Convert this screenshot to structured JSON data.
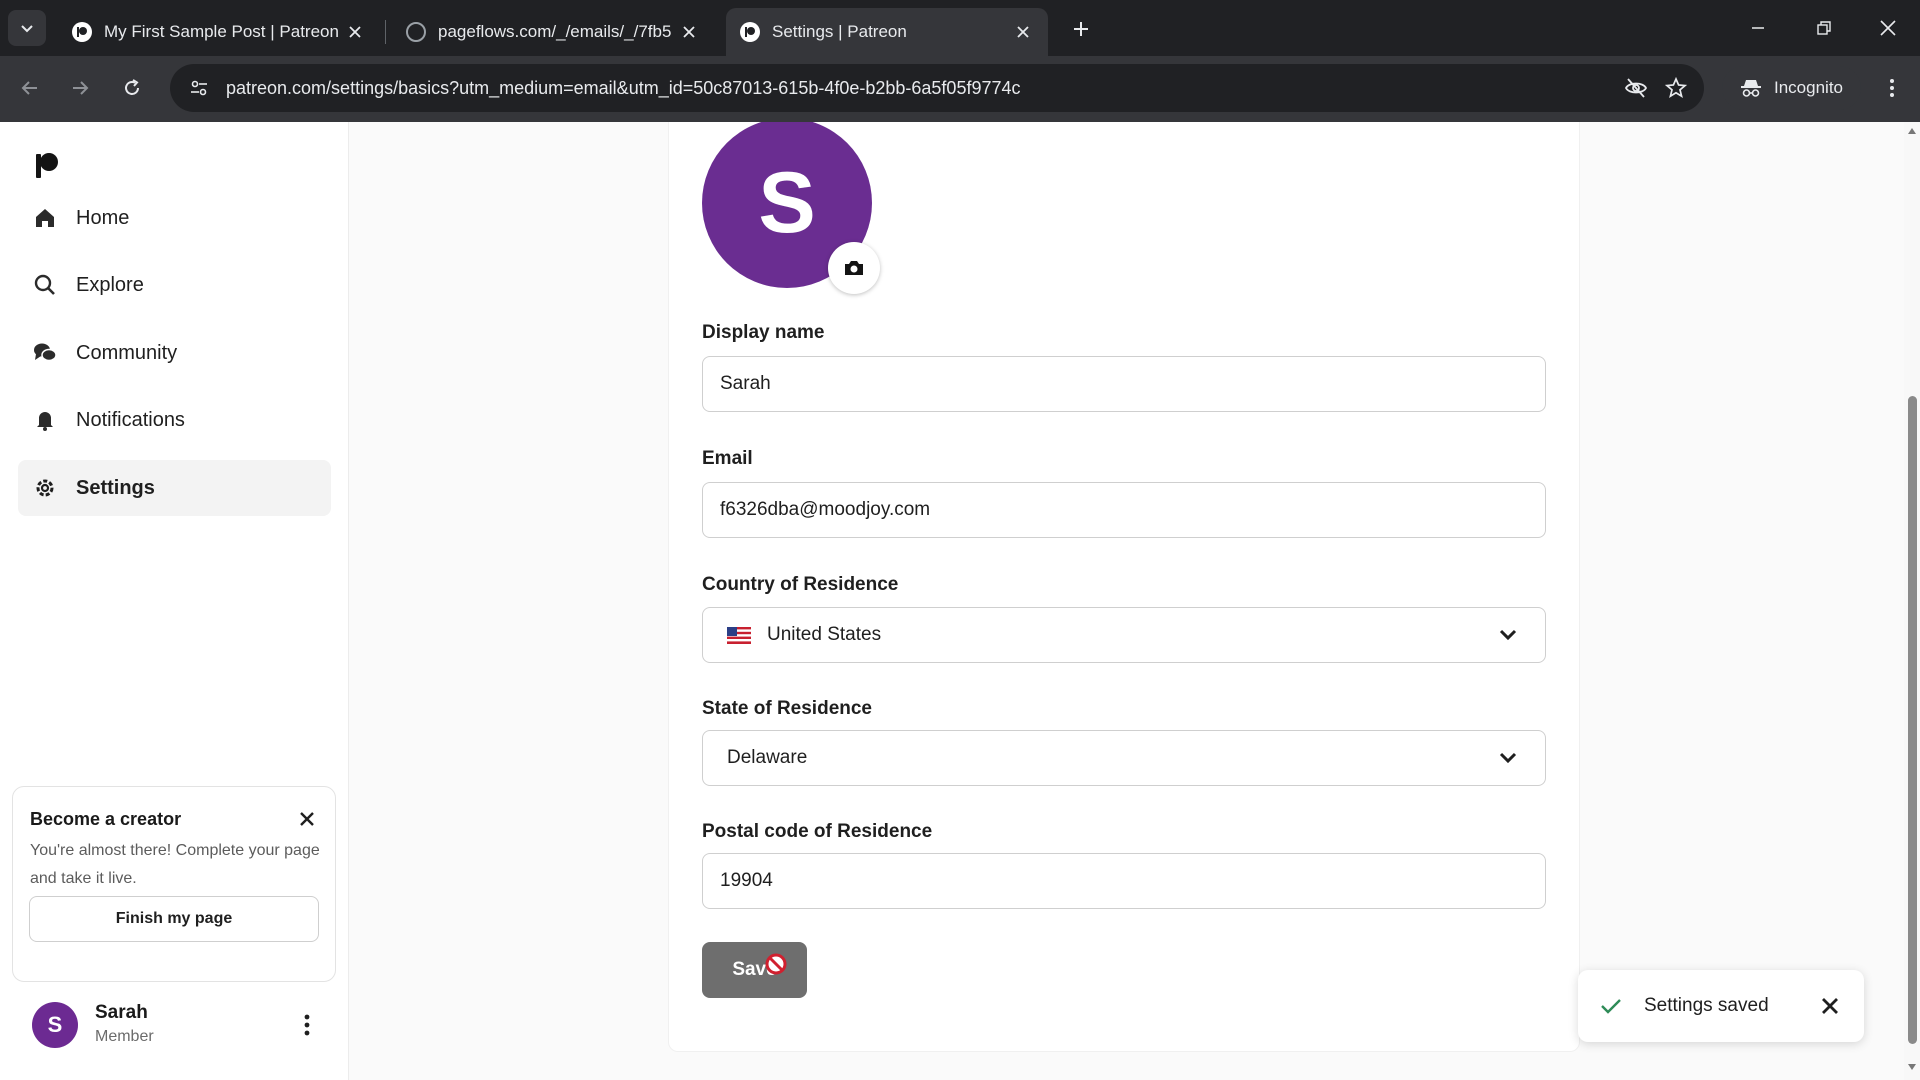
{
  "browser": {
    "tabs": [
      {
        "title": "My First Sample Post | Patreon",
        "active": false
      },
      {
        "title": "pageflows.com/_/emails/_/7fb5",
        "active": false
      },
      {
        "title": "Settings | Patreon",
        "active": true
      }
    ],
    "url": "patreon.com/settings/basics?utm_medium=email&utm_id=50c87013-615b-4f0e-b2bb-6a5f05f9774c",
    "incognito_label": "Incognito"
  },
  "sidebar": {
    "items": [
      {
        "label": "Home",
        "icon": "home-icon"
      },
      {
        "label": "Explore",
        "icon": "search-icon"
      },
      {
        "label": "Community",
        "icon": "chat-icon"
      },
      {
        "label": "Notifications",
        "icon": "bell-icon"
      },
      {
        "label": "Settings",
        "icon": "gear-icon",
        "selected": true
      }
    ],
    "creator_card": {
      "title": "Become a creator",
      "description": "You're almost there! Complete your page and take it live.",
      "button_label": "Finish my page"
    },
    "user": {
      "initial": "S",
      "name": "Sarah",
      "role": "Member"
    }
  },
  "settings": {
    "avatar_initial": "S",
    "display_name": {
      "label": "Display name",
      "value": "Sarah"
    },
    "email": {
      "label": "Email",
      "value": "f6326dba@moodjoy.com"
    },
    "country": {
      "label": "Country of Residence",
      "value": "United States"
    },
    "state": {
      "label": "State of Residence",
      "value": "Delaware"
    },
    "postal": {
      "label": "Postal code of Residence",
      "value": "19904"
    },
    "save_label": "Save"
  },
  "toast": {
    "message": "Settings saved"
  },
  "colors": {
    "avatar": "#6a2d91",
    "save_button": "#6e6e6e",
    "toast_check": "#2e8b57"
  }
}
